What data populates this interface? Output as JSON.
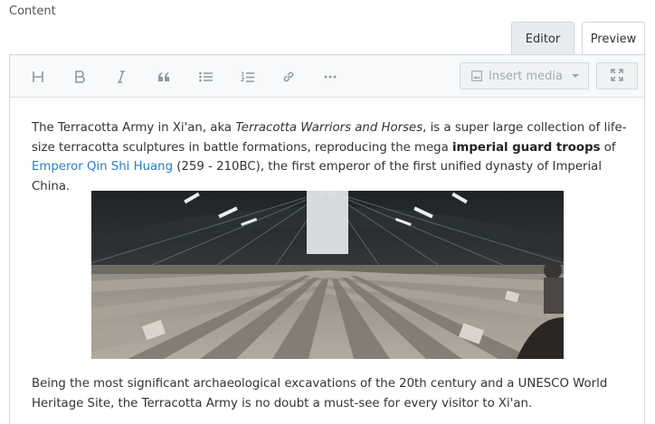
{
  "field": {
    "label": "Content"
  },
  "tabs": [
    {
      "label": "Editor",
      "active": true
    },
    {
      "label": "Preview",
      "active": false
    }
  ],
  "toolbar": {
    "buttons": [
      {
        "icon": "heading-icon"
      },
      {
        "icon": "bold-icon"
      },
      {
        "icon": "italic-icon"
      },
      {
        "icon": "quote-icon"
      },
      {
        "icon": "bulleted-list-icon"
      },
      {
        "icon": "numbered-list-icon"
      },
      {
        "icon": "link-icon"
      },
      {
        "icon": "more-icon"
      }
    ],
    "insert_media_label": "Insert media",
    "fullscreen_icon": "fullscreen-icon"
  },
  "body": {
    "p1": {
      "t1": "The Terracotta Army in Xi'an, aka ",
      "em1": "Terracotta Warriors and Horses",
      "t2": ", is a super large collection of life-size terracotta sculptures in battle formations, reproducing the mega ",
      "strong1": "imperial guard troops",
      "t3": " of ",
      "link1": "Emperor Qin Shi Huang",
      "t4": " (259 - 210BC), the first emperor of the first unified dynasty of Imperial China."
    },
    "image": {
      "subject": "panoramic photo of Terracotta Army pit hall"
    },
    "p2": "Being the most significant archaeological excavations of the 20th century and a UNESCO World Heritage Site, the Terracotta Army is no doubt a must-see for every visitor to Xi'an."
  },
  "colors": {
    "link": "#2a7dc4",
    "toolbar_icon": "#8f979e",
    "border": "#cfd6dd"
  }
}
